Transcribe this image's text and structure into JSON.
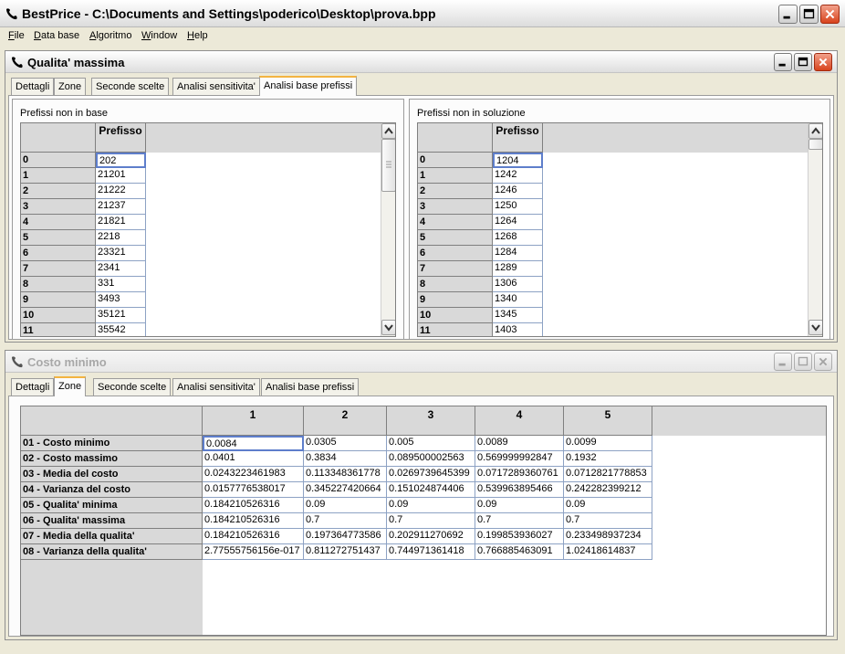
{
  "app": {
    "title": "BestPrice - C:\\Documents and Settings\\poderico\\Desktop\\prova.bpp",
    "icon": "phone-icon"
  },
  "menu": [
    {
      "label": "File",
      "u": "F",
      "rest": "ile"
    },
    {
      "label": "Data base",
      "u": "D",
      "rest": "ata base"
    },
    {
      "label": "Algoritmo",
      "u": "A",
      "rest": "lgoritmo"
    },
    {
      "label": "Window",
      "u": "W",
      "rest": "indow"
    },
    {
      "label": "Help",
      "u": "H",
      "rest": "elp"
    }
  ],
  "windows": {
    "qualita": {
      "title": "Qualita' massima",
      "tabs": [
        "Dettagli",
        "Zone",
        "Seconde scelte",
        "Analisi sensitivita'",
        "Analisi base prefissi"
      ],
      "active_tab": 4,
      "left_group": {
        "label": "Prefissi non in base",
        "column": "Prefisso",
        "rows": [
          {
            "idx": "0",
            "val": "202"
          },
          {
            "idx": "1",
            "val": "21201"
          },
          {
            "idx": "2",
            "val": "21222"
          },
          {
            "idx": "3",
            "val": "21237"
          },
          {
            "idx": "4",
            "val": "21821"
          },
          {
            "idx": "5",
            "val": "2218"
          },
          {
            "idx": "6",
            "val": "23321"
          },
          {
            "idx": "7",
            "val": "2341"
          },
          {
            "idx": "8",
            "val": "331"
          },
          {
            "idx": "9",
            "val": "3493"
          },
          {
            "idx": "10",
            "val": "35121"
          },
          {
            "idx": "11",
            "val": "35542"
          }
        ]
      },
      "right_group": {
        "label": "Prefissi non in soluzione",
        "column": "Prefisso",
        "rows": [
          {
            "idx": "0",
            "val": "1204"
          },
          {
            "idx": "1",
            "val": "1242"
          },
          {
            "idx": "2",
            "val": "1246"
          },
          {
            "idx": "3",
            "val": "1250"
          },
          {
            "idx": "4",
            "val": "1264"
          },
          {
            "idx": "5",
            "val": "1268"
          },
          {
            "idx": "6",
            "val": "1284"
          },
          {
            "idx": "7",
            "val": "1289"
          },
          {
            "idx": "8",
            "val": "1306"
          },
          {
            "idx": "9",
            "val": "1340"
          },
          {
            "idx": "10",
            "val": "1345"
          },
          {
            "idx": "11",
            "val": "1403"
          }
        ]
      }
    },
    "costo": {
      "title": "Costo minimo",
      "tabs": [
        "Dettagli",
        "Zone",
        "Seconde scelte",
        "Analisi sensitivita'",
        "Analisi base prefissi"
      ],
      "active_tab": 1,
      "columns": [
        "1",
        "2",
        "3",
        "4",
        "5"
      ],
      "rows": [
        {
          "label": "01 - Costo minimo",
          "values": [
            "0.0084",
            "0.0305",
            "0.005",
            "0.0089",
            "0.0099"
          ]
        },
        {
          "label": "02 - Costo massimo",
          "values": [
            "0.0401",
            "0.3834",
            "0.089500002563",
            "0.569999992847",
            "0.1932"
          ]
        },
        {
          "label": "03 - Media del costo",
          "values": [
            "0.0243223461983",
            "0.113348361778",
            "0.0269739645399",
            "0.0717289360761",
            "0.0712821778853"
          ]
        },
        {
          "label": "04 - Varianza del costo",
          "values": [
            "0.0157776538017",
            "0.345227420664",
            "0.151024874406",
            "0.539963895466",
            "0.242282399212"
          ]
        },
        {
          "label": "05 - Qualita' minima",
          "values": [
            "0.184210526316",
            "0.09",
            "0.09",
            "0.09",
            "0.09"
          ]
        },
        {
          "label": "06 - Qualita' massima",
          "values": [
            "0.184210526316",
            "0.7",
            "0.7",
            "0.7",
            "0.7"
          ]
        },
        {
          "label": "07 - Media della qualita'",
          "values": [
            "0.184210526316",
            "0.197364773586",
            "0.202911270692",
            "0.199853936027",
            "0.233498937234"
          ]
        },
        {
          "label": "08 - Varianza della qualita'",
          "values": [
            "2.77555756156e-017",
            "0.811272751437",
            "0.744971361418",
            "0.766885463091",
            "1.02418614837"
          ]
        }
      ]
    }
  }
}
